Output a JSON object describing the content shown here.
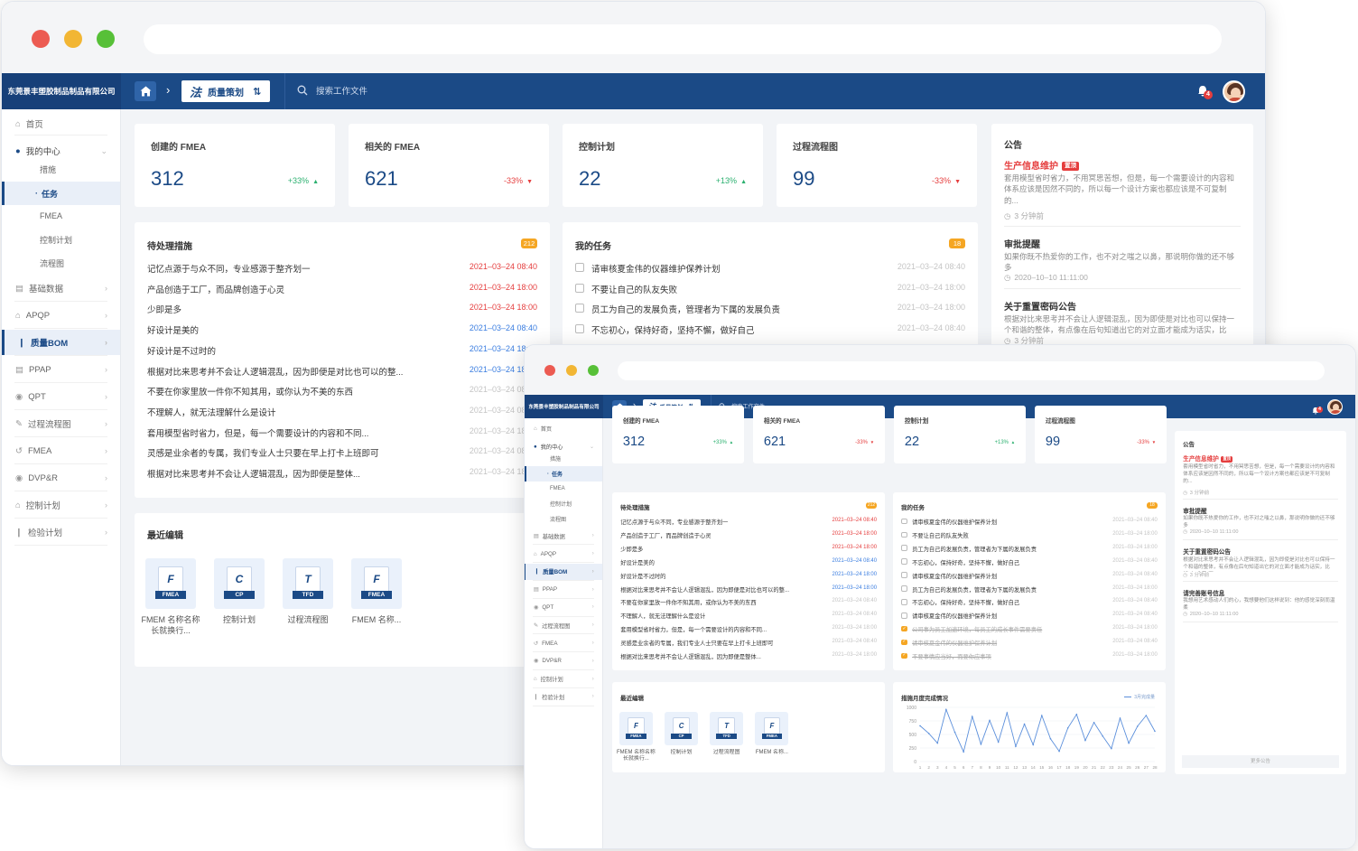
{
  "company": "东莞景丰塑胶制品制品有限公司",
  "breadcrumb": {
    "icon": "法",
    "label": "质量策划"
  },
  "search_placeholder": "搜索工作文件",
  "notification_count": "4",
  "sidebar": {
    "home": "首页",
    "my_center": "我的中心",
    "my_center_children": [
      "措施",
      "任务",
      "FMEA",
      "控制计划",
      "流程图"
    ],
    "items": [
      "基础数据",
      "APQP",
      "质量BOM",
      "PPAP",
      "QPT",
      "过程流程图",
      "FMEA",
      "DVP&R",
      "控制计划",
      "检验计划"
    ]
  },
  "stats": [
    {
      "title": "创建的 FMEA",
      "value": "312",
      "change": "+33%",
      "dir": "up"
    },
    {
      "title": "相关的 FMEA",
      "value": "621",
      "change": "-33%",
      "dir": "down"
    },
    {
      "title": "控制计划",
      "value": "22",
      "change": "+13%",
      "dir": "up"
    },
    {
      "title": "过程流程图",
      "value": "99",
      "change": "-33%",
      "dir": "down"
    }
  ],
  "pending": {
    "title": "待处理措施",
    "count": "212",
    "rows": [
      {
        "text": "记忆点源于与众不同，专业感源于整齐划一",
        "date": "2021–03–24 08:40",
        "color": "red"
      },
      {
        "text": "产品创造于工厂，而品牌创造于心灵",
        "date": "2021–03–24 18:00",
        "color": "red"
      },
      {
        "text": "少即是多",
        "date": "2021–03–24 18:00",
        "color": "red"
      },
      {
        "text": "好设计是美的",
        "date": "2021–03–24 08:40",
        "color": "blue"
      },
      {
        "text": "好设计是不过时的",
        "date": "2021–03–24 18:00",
        "color": "blue"
      },
      {
        "text": "根据对比来思考并不会让人逻辑混乱，因为即便是对比也可以的整...",
        "date": "2021–03–24 18:00",
        "color": "blue"
      },
      {
        "text": "不要在你家里放一件你不知其用，或你认为不美的东西",
        "date": "2021–03–24 08:40",
        "color": "grey"
      },
      {
        "text": "不理解人，就无法理解什么是设计",
        "date": "2021–03–24 08:40",
        "color": "grey"
      },
      {
        "text": "套用模型省时省力，但是，每一个需要设计的内容和不同...",
        "date": "2021–03–24 18:00",
        "color": "grey"
      },
      {
        "text": "灵感是业余者的专属，我们专业人士只要在早上打卡上班即可",
        "date": "2021–03–24 08:40",
        "color": "grey"
      },
      {
        "text": "根据对比来思考并不会让人逻辑混乱，因为即便是整体...",
        "date": "2021–03–24 18:00",
        "color": "grey"
      }
    ]
  },
  "tasks": {
    "title": "我的任务",
    "count": "18",
    "rows": [
      {
        "text": "请审核夏金伟的仪器维护保养计划",
        "date": "2021–03–24 08:40",
        "done": false
      },
      {
        "text": "不要让自己的队友失败",
        "date": "2021–03–24 18:00",
        "done": false
      },
      {
        "text": "员工为自己的发展负责，管理者为下属的发展负责",
        "date": "2021–03–24 18:00",
        "done": false
      },
      {
        "text": "不忘初心，保持好奇，坚持不懈，做好自己",
        "date": "2021–03–24 08:40",
        "done": false
      },
      {
        "text": "请审核夏金伟的仪器维护保养计划",
        "date": "2021–03–24 08:40",
        "done": false
      },
      {
        "text": "员工为自己的发展负责，管理者为下属的发展负责",
        "date": "2021–03–24 18:00",
        "done": false
      },
      {
        "text": "不忘初心，保持好奇，坚持不懈，做好自己",
        "date": "2021–03–24 08:40",
        "done": false
      },
      {
        "text": "请审核夏金伟的仪器维护保养计划",
        "date": "2021–03–24 08:40",
        "done": false
      },
      {
        "text": "公司事为员工加速环境，每员工的成长事件需要责任",
        "date": "2021–03–24 18:00",
        "done": true
      },
      {
        "text": "请审核夏金伟的仪器维护保养计划",
        "date": "2021–03–24 08:40",
        "done": true
      },
      {
        "text": "不要事情应当好，而要你应事项",
        "date": "2021–03–24 18:00",
        "done": true
      }
    ]
  },
  "recent": {
    "title": "最近编辑",
    "files": [
      {
        "letter": "F",
        "tag": "FMEA",
        "name": "FMEM 名称名称长就换行..."
      },
      {
        "letter": "C",
        "tag": "CP",
        "name": "控制计划"
      },
      {
        "letter": "T",
        "tag": "TFD",
        "name": "过程流程图"
      },
      {
        "letter": "F",
        "tag": "FMEA",
        "name": "FMEM 名称..."
      }
    ]
  },
  "announcements": {
    "title": "公告",
    "items": [
      {
        "title": "生产信息维护",
        "hot": "置顶",
        "body": "套用模型省时省力，不用冥思苦想，但是，每一个需要设计的内容和体系应该是因然不同的，所以每一个设计方案也都应该是不可复制的...",
        "time": "3 分钟前"
      },
      {
        "title": "审批提醒",
        "body": "如果你既不热爱你的工作，也不对之嗤之以鼻，那说明你做的还不够多",
        "time": "2020–10–10 11:11:00"
      },
      {
        "title": "关于重置密码公告",
        "body": "根据对比来思考并不会让人逻辑混乱，因为即使是对比也可以保持一个和谐的整体，有点像在后句知道出它的对立面才能成为话实，比如“上”含着“下”...",
        "time": "3 分钟前"
      },
      {
        "title": "请完善账号信息",
        "body": "我想用艺术感动人们的心，我想要他们这样说到：他的感觉深刻而温柔",
        "time": "2020–10–10 11:11:00"
      }
    ],
    "more": "更多公告"
  },
  "chart_data": {
    "type": "line",
    "title": "措施月度完成情况",
    "legend": "3月完成量",
    "x": [
      1,
      2,
      3,
      4,
      5,
      6,
      7,
      8,
      9,
      10,
      11,
      12,
      13,
      14,
      15,
      16,
      17,
      18,
      19,
      20,
      21,
      22,
      23,
      24,
      25,
      26,
      27,
      28
    ],
    "y": [
      660,
      520,
      340,
      960,
      540,
      180,
      830,
      320,
      760,
      360,
      900,
      280,
      690,
      310,
      850,
      420,
      190,
      620,
      870,
      390,
      720,
      470,
      240,
      800,
      340,
      650,
      850,
      560
    ],
    "ylim": [
      0,
      1000
    ],
    "yticks": [
      0,
      250,
      500,
      750,
      1000
    ]
  }
}
